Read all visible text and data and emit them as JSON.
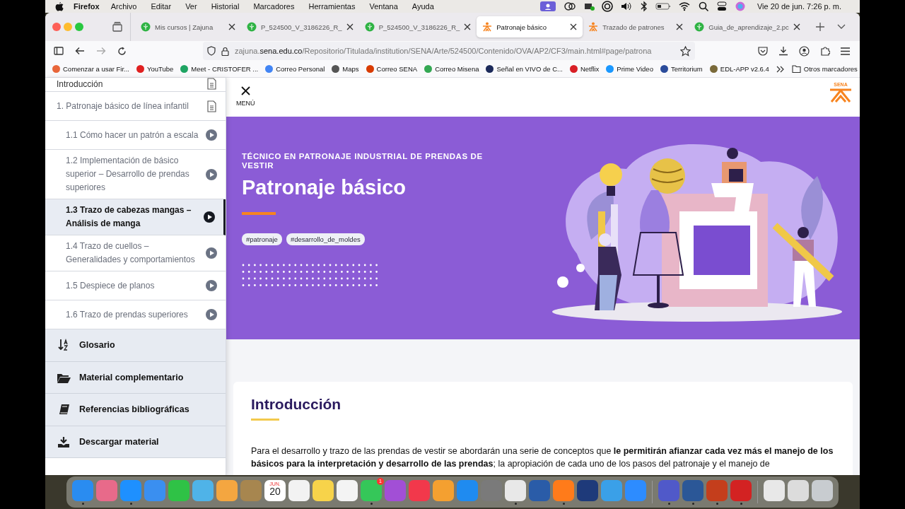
{
  "menubar": {
    "app": "Firefox",
    "items": [
      "Archivo",
      "Editar",
      "Ver",
      "Historial",
      "Marcadores",
      "Herramientas",
      "Ventana",
      "Ayuda"
    ],
    "clock": "Vie 20 de jun.  7:26 p. m."
  },
  "tabs": [
    {
      "title": "Mis cursos | Zajuna",
      "kind": "zajuna",
      "selected": false
    },
    {
      "title": "P_524500_V_3186226_R_",
      "kind": "zajuna",
      "selected": false
    },
    {
      "title": "P_524500_V_3186226_R_",
      "kind": "zajuna",
      "selected": false
    },
    {
      "title": "Patronaje básico",
      "kind": "sena",
      "selected": true
    },
    {
      "title": "Trazado de patrones",
      "kind": "sena",
      "selected": false
    },
    {
      "title": "Guia_de_aprendizaje_2.pc",
      "kind": "zajuna",
      "selected": false
    }
  ],
  "address": {
    "host_start": "zajuna.",
    "host": "sena.edu.co",
    "path": "/Repositorio/Titulada/institution/SENA/Arte/524500/Contenido/OVA/AP2/CF3/main.html#page/patrona"
  },
  "bookmarks": [
    {
      "label": "Comenzar a usar Fir...",
      "color": "#e8663a"
    },
    {
      "label": "YouTube",
      "color": "#e02020"
    },
    {
      "label": "Meet - CRISTOFER ...",
      "color": "#1fa463"
    },
    {
      "label": "Correo Personal",
      "color": "#4285f4"
    },
    {
      "label": "Maps",
      "color": "#555555"
    },
    {
      "label": "Correo SENA",
      "color": "#d83b01"
    },
    {
      "label": "Correo Misena",
      "color": "#34a853"
    },
    {
      "label": "Señal en VIVO de C...",
      "color": "#1c2a5a"
    },
    {
      "label": "Netflix",
      "color": "#d81f26"
    },
    {
      "label": "Prime Video",
      "color": "#1a98ff"
    },
    {
      "label": "Territorium",
      "color": "#2b4c9b"
    },
    {
      "label": "EDL-APP v2.6.4",
      "color": "#7a6a3a"
    }
  ],
  "bookmarks_folder": "Otros marcadores",
  "sidebar": {
    "items": [
      {
        "label": "Introducción",
        "kind": "doc",
        "selected": false
      },
      {
        "label": "1. Patronaje básico de línea infantil",
        "kind": "doc",
        "selected": false,
        "children": [
          {
            "label": "1.1 Cómo hacer un patrón a escala",
            "kind": "play",
            "selected": false
          },
          {
            "label": "1.2 Implementación de básico superior – Desarrollo de prendas superiores",
            "kind": "play",
            "selected": false
          },
          {
            "label": "1.3 Trazo de cabezas mangas – Análisis de manga",
            "kind": "play",
            "selected": true
          },
          {
            "label": "1.4 Trazo de cuellos – Generalidades y comportamientos",
            "kind": "play",
            "selected": false
          },
          {
            "label": "1.5 Despiece de planos",
            "kind": "play",
            "selected": false
          },
          {
            "label": "1.6 Trazo de prendas superiores",
            "kind": "play",
            "selected": false
          }
        ]
      }
    ],
    "sections": [
      {
        "label": "Glosario",
        "kind": "glossary"
      },
      {
        "label": "Material complementario",
        "kind": "folder"
      },
      {
        "label": "Referencias bibliográficas",
        "kind": "book"
      },
      {
        "label": "Descargar material",
        "kind": "download"
      }
    ]
  },
  "header": {
    "menu_label": "MENÚ",
    "logo_text": "SENA"
  },
  "hero": {
    "eyebrow": "TÉCNICO EN PATRONAJE INDUSTRIAL DE PRENDAS DE VESTIR",
    "title": "Patronaje básico",
    "tags": [
      "#patronaje",
      "#desarrollo_de_moldes"
    ]
  },
  "intro": {
    "heading": "Introducción",
    "paragraph": "Para el desarrollo y trazo de las prendas de vestir se abordarán una serie de conceptos que **le permitirán afianzar cada vez más el manejo de los básicos para la interpretación y desarrollo de las prendas**; la apropiación de cada uno de los pasos del patronaje y el manejo de"
  },
  "dock": [
    {
      "kind": "app",
      "color": "#2a8cf0",
      "running": true
    },
    {
      "kind": "app",
      "color": "#e86a8a",
      "running": false
    },
    {
      "kind": "app",
      "color": "#1e90ff",
      "running": true
    },
    {
      "kind": "app",
      "color": "#3a8ff0",
      "running": false
    },
    {
      "kind": "app",
      "color": "#2fc246",
      "running": false
    },
    {
      "kind": "app",
      "color": "#4fb3e8",
      "running": false
    },
    {
      "kind": "app",
      "color": "#f4a640",
      "running": false
    },
    {
      "kind": "app",
      "color": "#a7864f",
      "running": false
    },
    {
      "kind": "calendar",
      "month": "JUN.",
      "day": "20",
      "running": false
    },
    {
      "kind": "app",
      "color": "#f2f2f2",
      "running": false
    },
    {
      "kind": "app",
      "color": "#f7d34a",
      "running": false
    },
    {
      "kind": "app",
      "color": "#f4f4f4",
      "running": false
    },
    {
      "kind": "badge",
      "color": "#35c759",
      "badge": "1",
      "running": true
    },
    {
      "kind": "app",
      "color": "#a24fd6",
      "running": false
    },
    {
      "kind": "app",
      "color": "#f2384b",
      "running": false
    },
    {
      "kind": "app",
      "color": "#f4a030",
      "running": false
    },
    {
      "kind": "app",
      "color": "#1f8bf0",
      "running": false
    },
    {
      "kind": "app",
      "color": "#7a7a7a",
      "running": false
    },
    {
      "kind": "app",
      "color": "#e8e8e8",
      "running": true
    },
    {
      "kind": "app",
      "color": "#2a5ca8",
      "running": false
    },
    {
      "kind": "app",
      "color": "#ff7b1a",
      "running": true
    },
    {
      "kind": "app",
      "color": "#1e3a7a",
      "running": false
    },
    {
      "kind": "app",
      "color": "#3aa0e8",
      "running": false
    },
    {
      "kind": "app",
      "color": "#2d8cff",
      "running": false
    },
    {
      "kind": "app",
      "color": "#5059c9",
      "running": true
    },
    {
      "kind": "app",
      "color": "#2b5797",
      "running": true
    },
    {
      "kind": "app",
      "color": "#c43e1c",
      "running": true
    },
    {
      "kind": "app",
      "color": "#d32222",
      "running": true
    },
    {
      "kind": "app",
      "color": "#e8e8e8",
      "running": false
    },
    {
      "kind": "app",
      "color": "#dcdcdc",
      "running": false
    },
    {
      "kind": "app",
      "color": "#c8ccd0",
      "running": false
    }
  ]
}
